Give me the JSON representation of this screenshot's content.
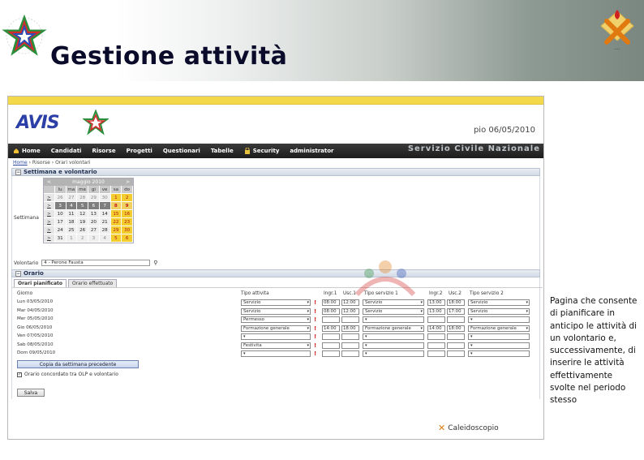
{
  "slide": {
    "title": "Gestione attività",
    "description_lines": [
      "Pagina che consente",
      "di pianificare in",
      "anticipo le attività di",
      "un volontario e,",
      "successivamente, di",
      "inserire le attività",
      "effettivamente",
      "svolte nel periodo",
      "stesso"
    ]
  },
  "app": {
    "brand": "AVIS",
    "user_date": "pio 06/05/2010",
    "nav": [
      {
        "label": "Home",
        "icon": "home-icon"
      },
      {
        "label": "Candidati",
        "icon": ""
      },
      {
        "label": "Risorse",
        "icon": ""
      },
      {
        "label": "Progetti",
        "icon": ""
      },
      {
        "label": "Questionari",
        "icon": ""
      },
      {
        "label": "Tabelle",
        "icon": ""
      },
      {
        "label": "Security",
        "icon": "lock-icon"
      },
      {
        "label": "administrator",
        "icon": ""
      }
    ],
    "nav_right": "Servizio Civile Nazionale",
    "breadcrumb": {
      "home": "Home",
      "rest": " › Risorse › Orari volontari"
    },
    "section1": {
      "title": "Settimana e volontario",
      "week_label": "Settimana",
      "calendar": {
        "month": "maggio 2010",
        "prev": "<",
        "next": ">",
        "dow": [
          "lu",
          "ma",
          "me",
          "gi",
          "ve",
          "sa",
          "do"
        ],
        "weeks": [
          {
            "wk": "",
            "days": [
              "26",
              "27",
              "28",
              "29",
              "30",
              "1",
              "2"
            ]
          },
          {
            "wk": "",
            "days": [
              "3",
              "4",
              "5",
              "6",
              "7",
              "8",
              "9"
            ]
          },
          {
            "wk": "",
            "days": [
              "10",
              "11",
              "12",
              "13",
              "14",
              "15",
              "16"
            ]
          },
          {
            "wk": "",
            "days": [
              "17",
              "18",
              "19",
              "20",
              "21",
              "22",
              "23"
            ]
          },
          {
            "wk": "",
            "days": [
              "24",
              "25",
              "26",
              "27",
              "28",
              "29",
              "30"
            ]
          },
          {
            "wk": "",
            "days": [
              "31",
              "1",
              "2",
              "3",
              "4",
              "5",
              "6"
            ]
          }
        ]
      },
      "volunteer_label": "Volontario",
      "volunteer_value": "4 - Perone Fausta"
    },
    "section2": {
      "title": "Orario",
      "tabs": [
        "Orari pianificato",
        "Orario effettuato"
      ],
      "headers": {
        "day": "Giorno",
        "type": "Tipo attivita",
        "in1": "Ingr.1",
        "out1": "Usc.1",
        "svc1": "Tipo servizio 1",
        "in2": "Ingr.2",
        "out2": "Usc.2",
        "svc2": "Tipo servizio 2"
      },
      "rows": [
        {
          "day": "Lun 03/05/2010",
          "type": "Servizio",
          "in1": "08:00",
          "out1": "12:00",
          "svc1": "Servizio",
          "in2": "13:00",
          "out2": "18:00",
          "svc2": "Servizio"
        },
        {
          "day": "Mar 04/05/2010",
          "type": "Servizio",
          "in1": "08:00",
          "out1": "12:00",
          "svc1": "Servizio",
          "in2": "13:00",
          "out2": "17:00",
          "svc2": "Servizio"
        },
        {
          "day": "Mer 05/05/2010",
          "type": "Permesso",
          "in1": "",
          "out1": "",
          "svc1": "",
          "in2": "",
          "out2": "",
          "svc2": ""
        },
        {
          "day": "Gio 06/05/2010",
          "type": "Formazione generale",
          "in1": "14:00",
          "out1": "18:00",
          "svc1": "Formazione generale",
          "in2": "14:00",
          "out2": "18:00",
          "svc2": "Formazione generale"
        },
        {
          "day": "Ven 07/05/2010",
          "type": "",
          "in1": "",
          "out1": "",
          "svc1": "",
          "in2": "",
          "out2": "",
          "svc2": ""
        },
        {
          "day": "Sab 08/05/2010",
          "type": "Festivita",
          "in1": "",
          "out1": "",
          "svc1": "",
          "in2": "",
          "out2": "",
          "svc2": ""
        },
        {
          "day": "Dom 09/05/2010",
          "type": "",
          "in1": "",
          "out1": "",
          "svc1": "",
          "in2": "",
          "out2": "",
          "svc2": ""
        }
      ],
      "copy_button": "Copia da settimana precedente",
      "agreement_label": "Orario concordato tra OLP e volontario",
      "save_button": "Salva"
    },
    "footer_logo": "Caleidoscopio"
  },
  "colors": {
    "title": "#0a0a2a",
    "navbar": "#1c1c1c",
    "calendar_weekend": "#f3cc2e",
    "brand": "#2c3fa6"
  }
}
